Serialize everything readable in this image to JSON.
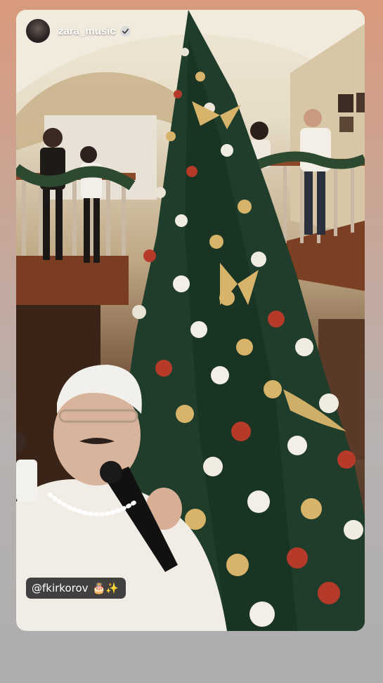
{
  "story": {
    "username": "zara_music",
    "mention": "@fkirkorov",
    "mention_emoji": "🎂✨",
    "verified": true
  },
  "colors": {
    "background_top": "#d99a7c",
    "background_bottom": "#adadad",
    "sticker_bg": "#282828",
    "tree_green": "#1f3d2a",
    "ornament_gold": "#d8b46a"
  },
  "icons": {
    "verified": "verified-badge-icon",
    "avatar": "profile-avatar"
  }
}
